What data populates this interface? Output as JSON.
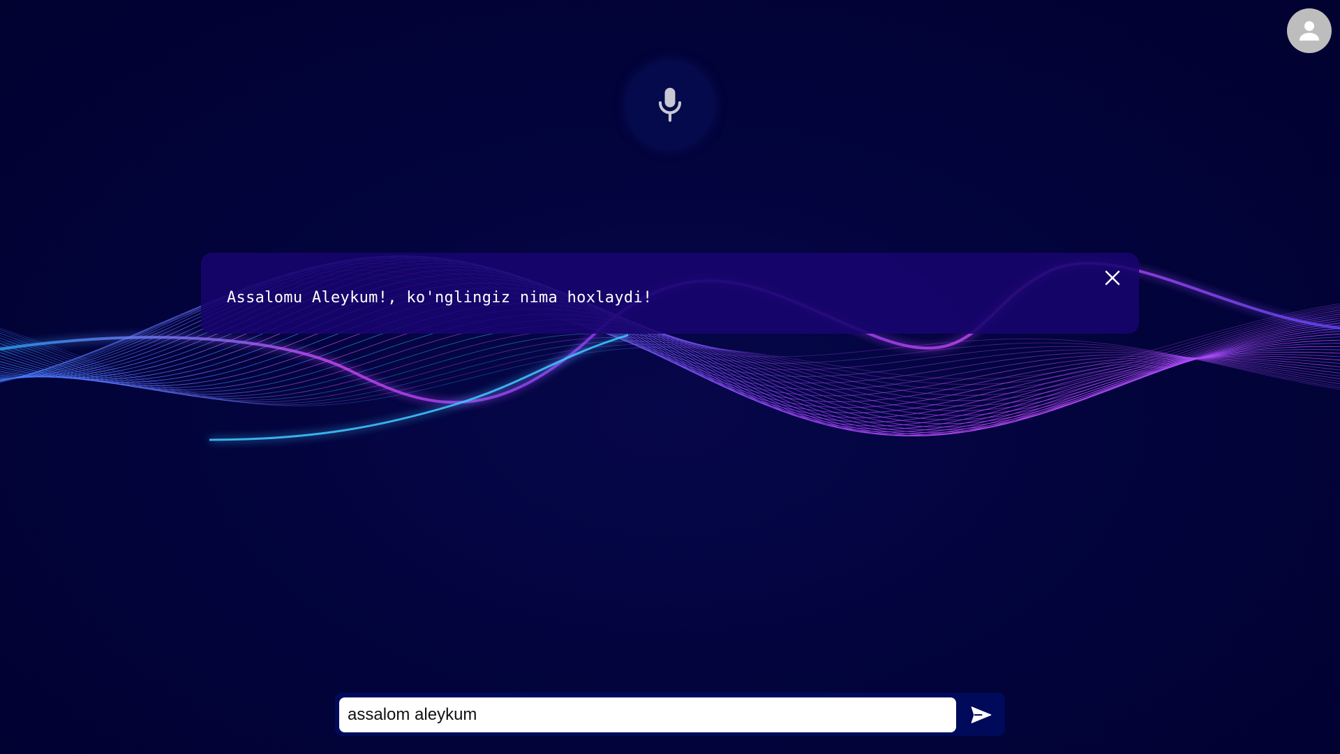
{
  "header": {
    "avatar_icon": "user-avatar-icon"
  },
  "mic": {
    "icon": "microphone-icon"
  },
  "message": {
    "text": "Assalomu Aleykum!, ko'nglingiz nima hoxlaydi!",
    "close_icon": "close-icon"
  },
  "chat": {
    "input_value": "assalom aleykum",
    "send_icon": "send-icon"
  },
  "colors": {
    "background": "#02033a",
    "message_box": "#18046e",
    "wave_primary": "#8a3cff",
    "wave_secondary": "#d24cff",
    "wave_accent": "#2ea8ff",
    "input_bar": "#000a5a"
  }
}
